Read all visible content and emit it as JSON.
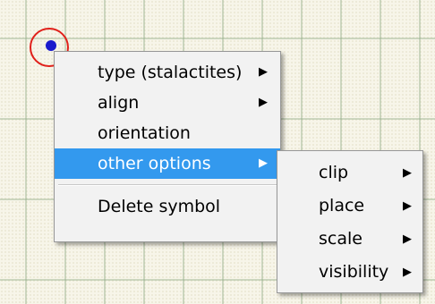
{
  "context_menu": {
    "items": [
      {
        "label": "type (stalactites)",
        "has_submenu": true
      },
      {
        "label": "align",
        "has_submenu": true
      },
      {
        "label": "orientation",
        "has_submenu": false
      },
      {
        "label": "other options",
        "has_submenu": true,
        "highlighted": true
      }
    ],
    "delete_label": "Delete symbol"
  },
  "submenu": {
    "items": [
      {
        "label": "clip",
        "has_submenu": true
      },
      {
        "label": "place",
        "has_submenu": true
      },
      {
        "label": "scale",
        "has_submenu": true
      },
      {
        "label": "visibility",
        "has_submenu": true
      }
    ]
  },
  "colors": {
    "highlight": "#3399ee",
    "menu_background": "#f2f2f2",
    "symbol_ring": "#e0201a",
    "symbol_dot": "#1a1acc"
  },
  "icons": {
    "submenu_arrow": "triangle-right-icon"
  }
}
